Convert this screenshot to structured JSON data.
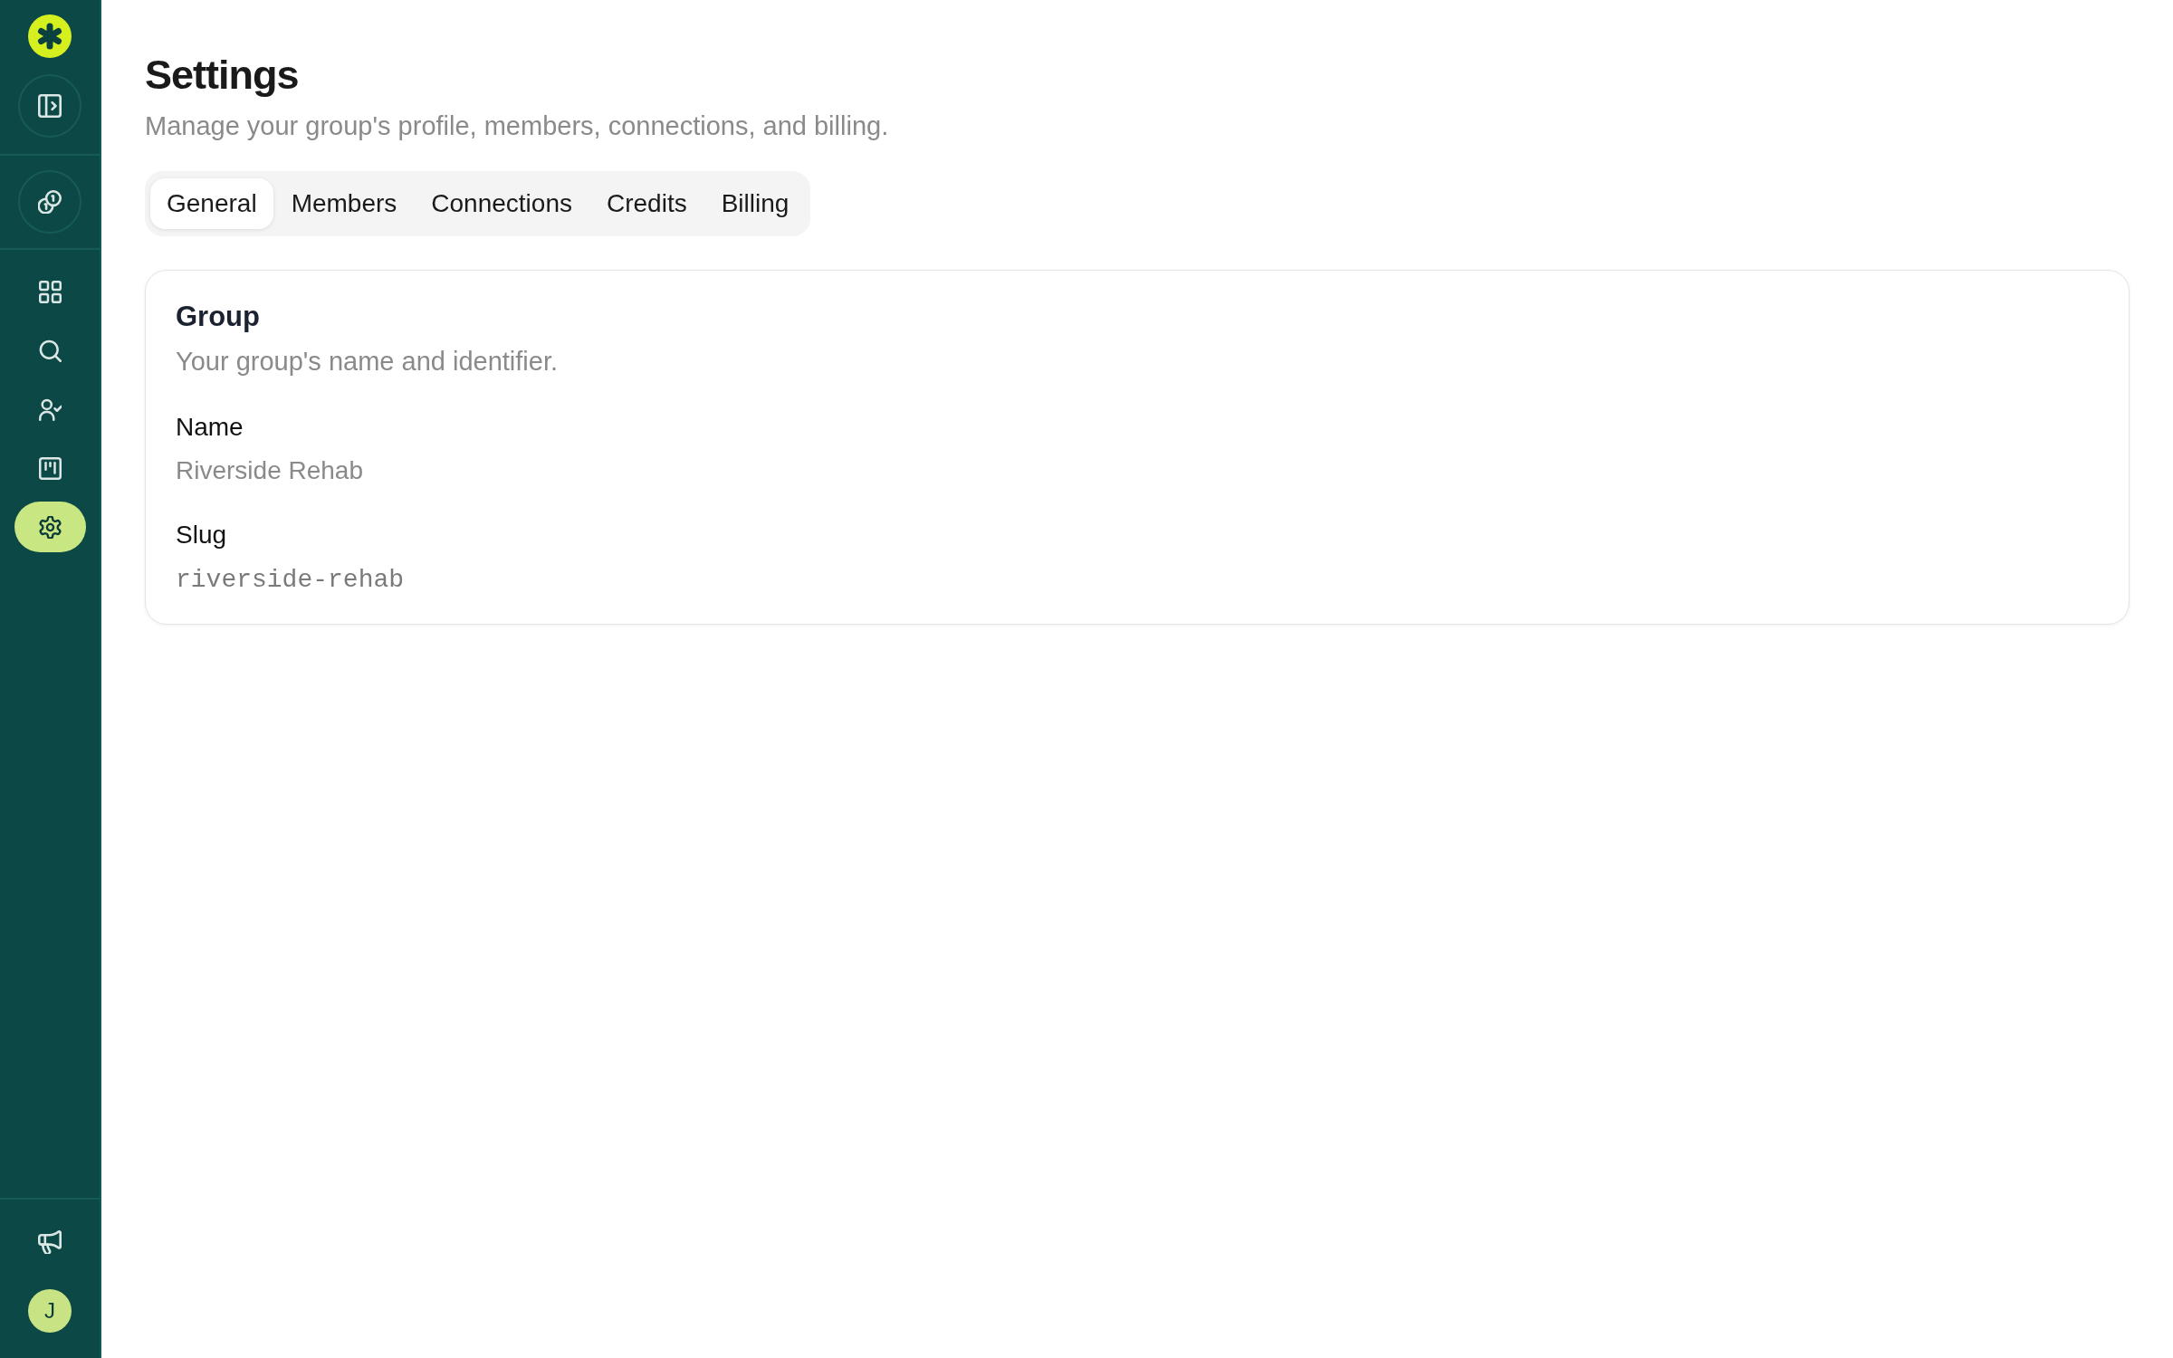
{
  "sidebar": {
    "nav_items": [
      {
        "selected": false
      },
      {
        "selected": false
      },
      {
        "selected": false
      },
      {
        "selected": false
      },
      {
        "selected": true
      }
    ],
    "avatar": {
      "initial": "J"
    }
  },
  "page": {
    "title": "Settings",
    "subtitle": "Manage your group's profile, members, connections, and billing."
  },
  "tabs": [
    {
      "label": "General",
      "selected": true
    },
    {
      "label": "Members",
      "selected": false
    },
    {
      "label": "Connections",
      "selected": false
    },
    {
      "label": "Credits",
      "selected": false
    },
    {
      "label": "Billing",
      "selected": false
    }
  ],
  "group_card": {
    "title": "Group",
    "description": "Your group's name and identifier.",
    "fields": [
      {
        "label": "Name",
        "value": "Riverside Rehab",
        "kind": "text"
      },
      {
        "label": "Slug",
        "value": "riverside-rehab",
        "kind": "code"
      }
    ]
  }
}
